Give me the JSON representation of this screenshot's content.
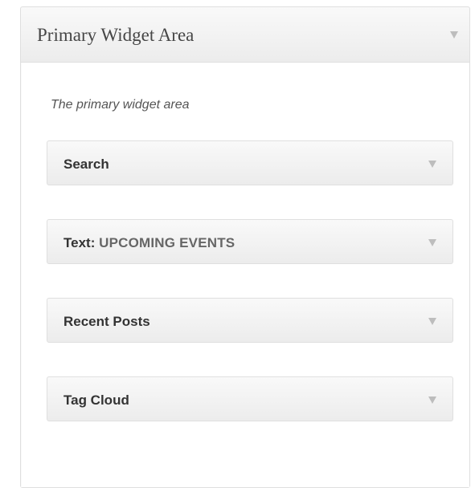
{
  "sidebar": {
    "title": "Primary Widget Area",
    "description": "The primary widget area",
    "widgets": [
      {
        "label": "Search",
        "subtitle": ""
      },
      {
        "label": "Text:",
        "subtitle": "UPCOMING EVENTS"
      },
      {
        "label": "Recent Posts",
        "subtitle": ""
      },
      {
        "label": "Tag Cloud",
        "subtitle": ""
      }
    ]
  },
  "icons": {
    "collapse": "chevron-down-icon"
  }
}
